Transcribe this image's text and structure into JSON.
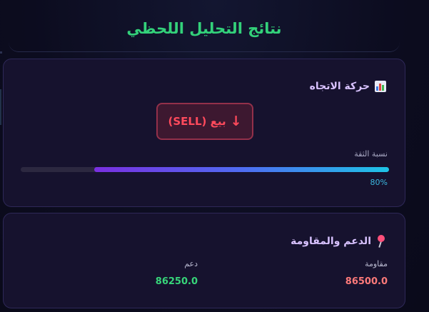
{
  "page": {
    "title": "نتائج التحليل اللحظي"
  },
  "trend_card": {
    "heading": "حركة الاتجاه",
    "icon": "bar-chart-icon",
    "signal": {
      "arrow": "↓",
      "label": "بيع (SELL)",
      "color": "#ff4a5c"
    },
    "confidence_label": "نسبة الثقة",
    "confidence_percent": 80,
    "confidence_text": "80%"
  },
  "levels_card": {
    "heading": "الدعم والمقاومة",
    "icon": "pin-icon",
    "resistance": {
      "label": "مقاومة",
      "value": "86500.0",
      "color": "#ff7a7a"
    },
    "support": {
      "label": "دعم",
      "value": "86250.0",
      "color": "#37d67a"
    }
  },
  "colors": {
    "title": "#33d17a",
    "heading": "#d8c2ff",
    "card_bg": "#16122e",
    "card_border": "#2e2858"
  }
}
